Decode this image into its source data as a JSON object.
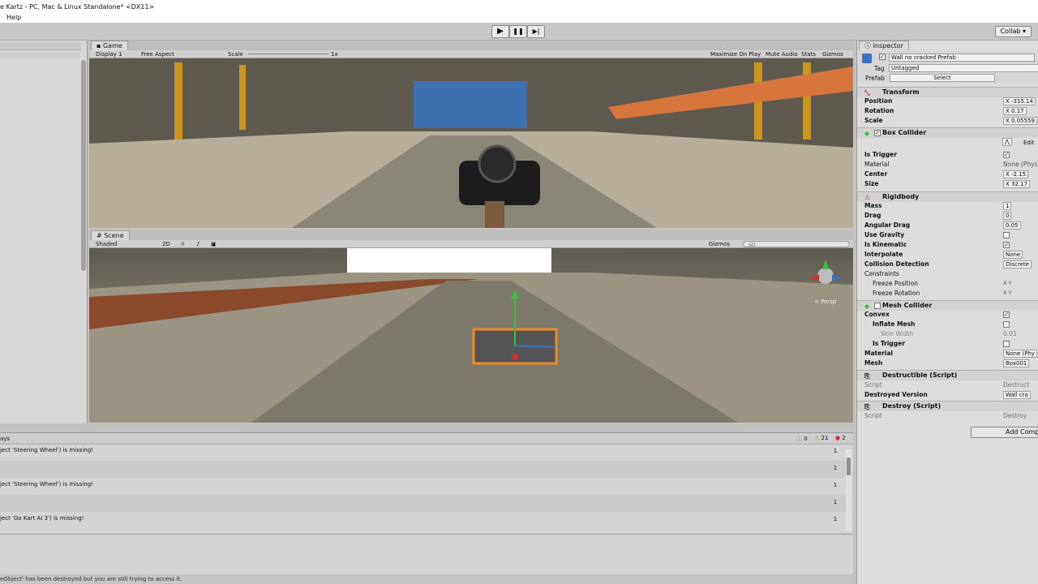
{
  "window": {
    "title": "e Kartz - PC, Mac & Linux Standalone* <DX11>"
  },
  "menu": {
    "help": "Help"
  },
  "toolbar": {
    "play": "▶",
    "pause": "❚❚",
    "step": "▶|",
    "collab": "Collab ▾"
  },
  "game": {
    "tab": "Game",
    "display": "Display 1",
    "aspect": "Free Aspect",
    "scale_label": "Scale",
    "scale_value": "1x",
    "maximize": "Maximize On Play",
    "mute": "Mute Audio",
    "stats": "Stats",
    "gizmos": "Gizmos"
  },
  "scene": {
    "tab": "Scene",
    "shading": "Shaded",
    "mode2d": "2D",
    "gizmos": "Gizmos",
    "search": "All",
    "persp": "< Persp"
  },
  "console": {
    "tab_prefix": "ays",
    "counts": {
      "info": "0",
      "warn": "21",
      "error": "2"
    },
    "rows": [
      {
        "msg": "ject 'Steering Wheel') is missing!",
        "count": "1"
      },
      {
        "msg": "",
        "count": "1"
      },
      {
        "msg": "ject 'Steering Wheel') is missing!",
        "count": "1"
      },
      {
        "msg": "",
        "count": "1"
      },
      {
        "msg": "ject 'Go Kart AI 3') is missing!",
        "count": "1"
      }
    ],
    "status": "eObject' has been destroyed but you are still trying to access it."
  },
  "inspector": {
    "tab": "Inspector",
    "object_name": "Wall no cracked Prefab",
    "tag_label": "Tag",
    "tag_value": "Untagged",
    "prefab_label": "Prefab",
    "prefab_select": "Select",
    "transform": {
      "title": "Transform",
      "position_label": "Position",
      "position_x": "X -315.14",
      "rotation_label": "Rotation",
      "rotation_x": "X 0.17",
      "scale_label": "Scale",
      "scale_x": "X 0.05559"
    },
    "box_collider": {
      "title": "Box Collider",
      "edit": "Edit",
      "is_trigger": "Is Trigger",
      "material_label": "Material",
      "material_value": "None (Phys",
      "center_label": "Center",
      "center_x": "X -2.15",
      "size_label": "Size",
      "size_x": "X 32.17"
    },
    "rigidbody": {
      "title": "Rigidbody",
      "mass_label": "Mass",
      "mass": "1",
      "drag_label": "Drag",
      "drag": "0",
      "angular_drag_label": "Angular Drag",
      "angular_drag": "0.05",
      "use_gravity": "Use Gravity",
      "is_kinematic": "Is Kinematic",
      "interpolate_label": "Interpolate",
      "interpolate": "None",
      "collision_label": "Collision Detection",
      "collision": "Discrete",
      "constraints": "Constraints",
      "freeze_position": "Freeze Position",
      "freeze_rotation": "Freeze Rotation",
      "xyz": "X Y"
    },
    "mesh_collider": {
      "title": "Mesh Collider",
      "convex": "Convex",
      "inflate": "Inflate Mesh",
      "skin_width_label": "Skin Width",
      "skin_width": "0.01",
      "is_trigger": "Is Trigger",
      "material_label": "Material",
      "material_value": "None (Phy",
      "mesh_label": "Mesh",
      "mesh_value": "Box001"
    },
    "destructible": {
      "title": "Destructible (Script)",
      "script_label": "Script",
      "script_value": "Destruct",
      "destroyed_label": "Destroyed Version",
      "destroyed_value": "Wall cra"
    },
    "destroy": {
      "title": "Destroy (Script)",
      "script_label": "Script",
      "script_value": "Destroy"
    },
    "add_component": "Add Comp"
  },
  "colors": {
    "accent": "#3a72c4",
    "selection": "#f08a24",
    "error": "#d23030"
  }
}
